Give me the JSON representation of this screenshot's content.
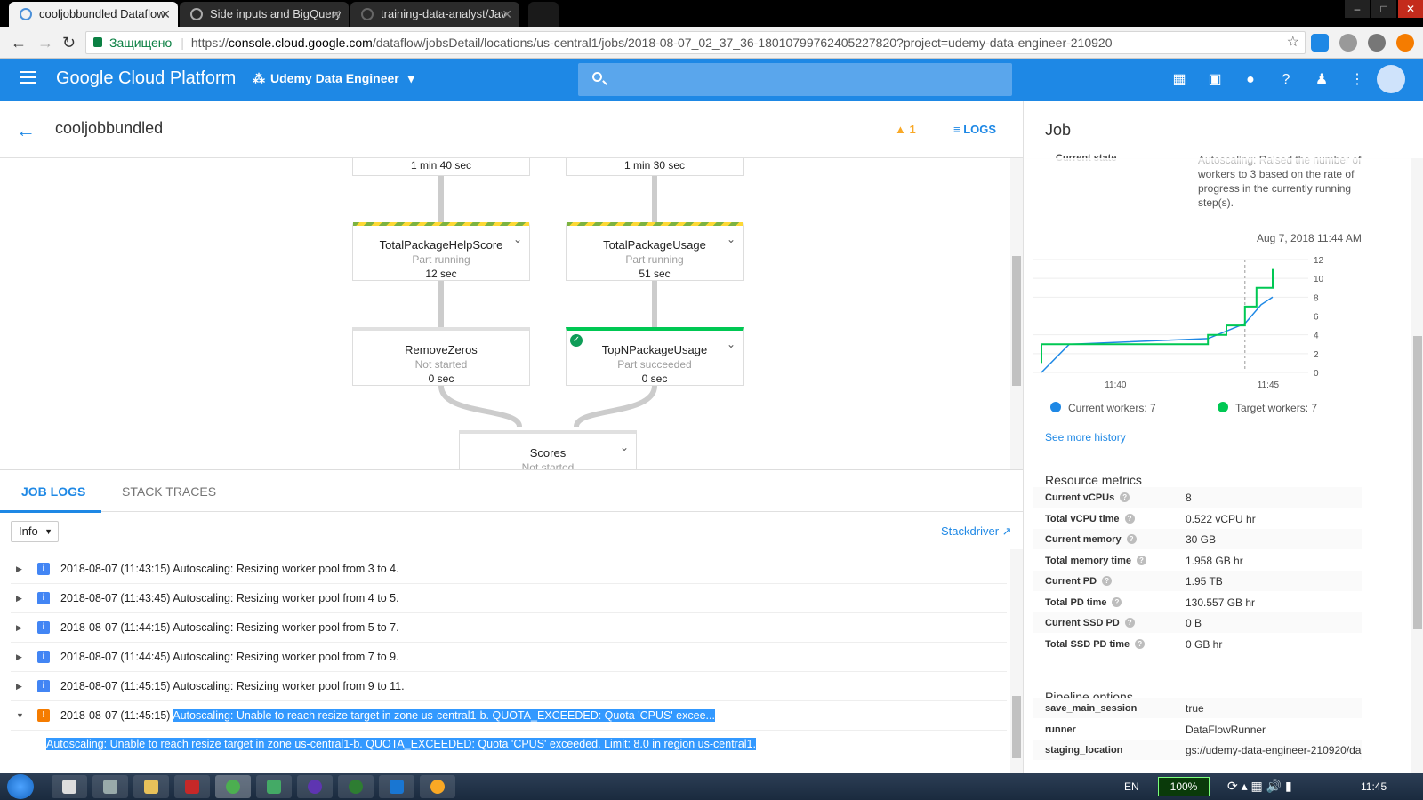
{
  "browser": {
    "tabs": [
      {
        "title": "cooljobbundled Dataflow",
        "active": true
      },
      {
        "title": "Side inputs and BigQuery",
        "active": false
      },
      {
        "title": "training-data-analyst/Jav",
        "active": false
      }
    ],
    "secure_label": "Защищено",
    "url_scheme": "https://",
    "url_host": "console.cloud.google.com",
    "url_path": "/dataflow/jobsDetail/locations/us-central1/jobs/2018-08-07_02_37_36-18010799762405227820?project=udemy-data-engineer-210920",
    "window_controls": [
      "–",
      "□",
      "✕"
    ]
  },
  "gcp": {
    "product": "Google Cloud Platform",
    "project": "Udemy Data Engineer",
    "icons": [
      "gift-icon",
      "cloud-shell-icon",
      "feedback-icon",
      "help-icon",
      "notifications-icon",
      "more-icon"
    ]
  },
  "job": {
    "name": "cooljobbundled",
    "warnings": "1",
    "logs_label": "LOGS"
  },
  "graph": {
    "top_nodes": [
      {
        "duration": "1 min 40 sec"
      },
      {
        "duration": "1 min 30 sec"
      }
    ],
    "nodes": [
      {
        "name": "TotalPackageHelpScore",
        "status": "Part running",
        "duration": "12 sec"
      },
      {
        "name": "TotalPackageUsage",
        "status": "Part running",
        "duration": "51 sec"
      },
      {
        "name": "RemoveZeros",
        "status": "Not started",
        "duration": "0 sec"
      },
      {
        "name": "TopNPackageUsage",
        "status": "Part succeeded",
        "duration": "0 sec"
      },
      {
        "name": "Scores",
        "status": "Not started",
        "duration": ""
      }
    ]
  },
  "logs": {
    "tabs": [
      "JOB LOGS",
      "STACK TRACES"
    ],
    "level": "Info",
    "stackdriver": "Stackdriver",
    "rows": [
      {
        "level": "info",
        "time": "2018-08-07 (11:43:15)",
        "message": "Autoscaling: Resizing worker pool from 3 to 4."
      },
      {
        "level": "info",
        "time": "2018-08-07 (11:43:45)",
        "message": "Autoscaling: Resizing worker pool from 4 to 5."
      },
      {
        "level": "info",
        "time": "2018-08-07 (11:44:15)",
        "message": "Autoscaling: Resizing worker pool from 5 to 7."
      },
      {
        "level": "info",
        "time": "2018-08-07 (11:44:45)",
        "message": "Autoscaling: Resizing worker pool from 7 to 9."
      },
      {
        "level": "info",
        "time": "2018-08-07 (11:45:15)",
        "message": "Autoscaling: Resizing worker pool from 9 to 11."
      },
      {
        "level": "warning",
        "time": "2018-08-07 (11:45:15)",
        "message": "Autoscaling: Unable to reach resize target in zone us-central1-b. QUOTA_EXCEEDED: Quota 'CPUS' excee..."
      }
    ],
    "detail": "Autoscaling: Unable to reach resize target in zone us-central1-b. QUOTA_EXCEEDED: Quota 'CPUS' exceeded.  Limit: 8.0 in region us-central1."
  },
  "panel": {
    "title": "Job",
    "current_state_label": "Current state",
    "current_state_lines": [
      "Autoscaling: Raised the number of",
      "workers to 3 based on the rate of",
      "progress in the currently running",
      "step(s)."
    ],
    "chart_timestamp": "Aug 7, 2018 11:44 AM",
    "legend_current": "Current workers: 7",
    "legend_target": "Target workers: 7",
    "see_more_history": "See more history",
    "resource_metrics_title": "Resource metrics",
    "metrics": [
      {
        "label": "Current vCPUs",
        "value": "8"
      },
      {
        "label": "Total vCPU time",
        "value": "0.522 vCPU hr"
      },
      {
        "label": "Current memory",
        "value": "30 GB"
      },
      {
        "label": "Total memory time",
        "value": "1.958 GB hr"
      },
      {
        "label": "Current PD",
        "value": "1.95 TB"
      },
      {
        "label": "Total PD time",
        "value": "130.557 GB hr"
      },
      {
        "label": "Current SSD PD",
        "value": "0 B"
      },
      {
        "label": "Total SSD PD time",
        "value": "0 GB hr"
      }
    ],
    "pipeline_options_title": "Pipeline options",
    "options": [
      {
        "label": "save_main_session",
        "value": "true"
      },
      {
        "label": "runner",
        "value": "DataFlowRunner"
      },
      {
        "label": "staging_location",
        "value": "gs://udemy-data-engineer-210920/da"
      }
    ]
  },
  "chart_data": {
    "type": "line",
    "x_ticks": [
      "11:40",
      "11:45"
    ],
    "y_ticks": [
      0,
      2,
      4,
      6,
      8,
      10,
      12
    ],
    "ylim": [
      0,
      12
    ],
    "series": [
      {
        "name": "Current workers",
        "color": "#1e88e5",
        "points": [
          [
            0,
            0
          ],
          [
            0.12,
            3
          ],
          [
            0.72,
            3.6
          ],
          [
            0.8,
            4.4
          ],
          [
            0.88,
            5.2
          ],
          [
            0.95,
            7.2
          ],
          [
            1.0,
            8
          ]
        ]
      },
      {
        "name": "Target workers",
        "color": "#00c853",
        "points": [
          [
            0,
            1
          ],
          [
            0,
            3
          ],
          [
            0.72,
            3
          ],
          [
            0.72,
            4
          ],
          [
            0.8,
            4
          ],
          [
            0.8,
            5
          ],
          [
            0.88,
            5
          ],
          [
            0.88,
            7
          ],
          [
            0.93,
            7
          ],
          [
            0.93,
            9
          ],
          [
            1.0,
            9
          ],
          [
            1.0,
            11
          ]
        ]
      }
    ],
    "marker_x": 0.88
  },
  "taskbar": {
    "language": "EN",
    "battery": "100%",
    "clock": "11:45"
  }
}
